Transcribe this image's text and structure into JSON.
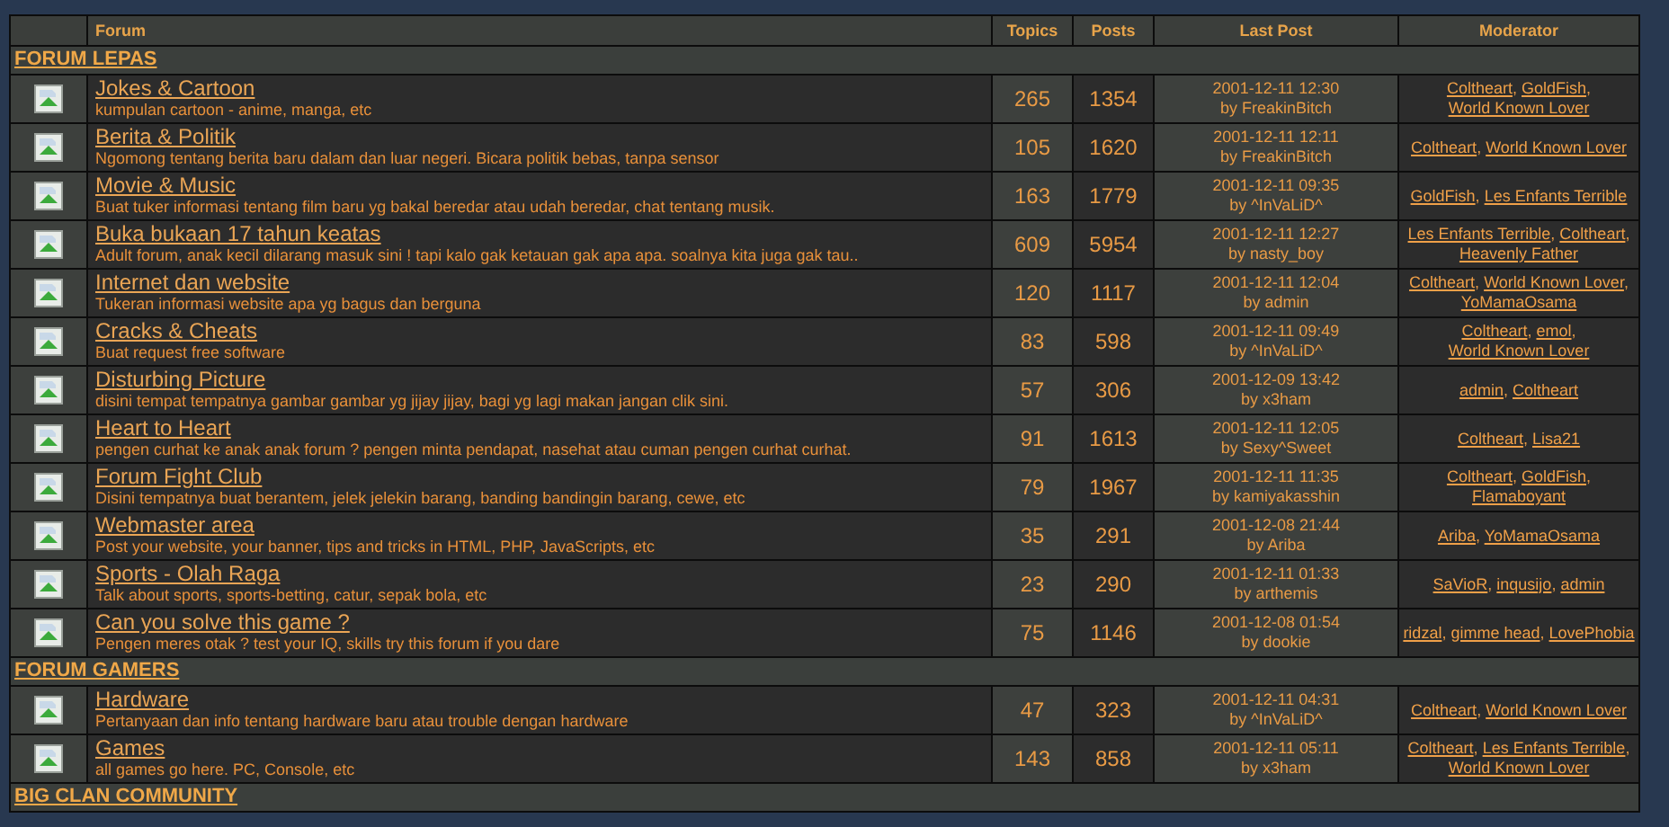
{
  "table": {
    "columns": [
      "Forum",
      "Topics",
      "Posts",
      "Last Post",
      "Moderator"
    ],
    "moderator_separator": ",",
    "categories": [
      {
        "title": "FORUM LEPAS",
        "forums": [
          {
            "name": "Jokes & Cartoon",
            "description": "kumpulan cartoon - anime, manga, etc",
            "topics": "265",
            "posts": "1354",
            "last_post": {
              "date": "2001-12-11 12:30",
              "by": "by FreakinBitch"
            },
            "moderators": [
              "Coltheart",
              "GoldFish",
              "World Known Lover"
            ]
          },
          {
            "name": "Berita & Politik",
            "description": "Ngomong tentang berita baru dalam dan luar negeri. Bicara politik bebas, tanpa sensor",
            "topics": "105",
            "posts": "1620",
            "last_post": {
              "date": "2001-12-11 12:11",
              "by": "by FreakinBitch"
            },
            "moderators": [
              "Coltheart",
              "World Known Lover"
            ]
          },
          {
            "name": "Movie & Music",
            "description": "Buat tuker informasi tentang film baru yg bakal beredar atau udah beredar, chat tentang musik.",
            "topics": "163",
            "posts": "1779",
            "last_post": {
              "date": "2001-12-11 09:35",
              "by": "by ^InVaLiD^"
            },
            "moderators": [
              "GoldFish",
              "Les Enfants Terrible"
            ]
          },
          {
            "name": "Buka bukaan 17 tahun keatas",
            "description": "Adult forum, anak kecil dilarang masuk sini ! tapi kalo gak ketauan gak apa apa. soalnya kita juga gak tau..",
            "topics": "609",
            "posts": "5954",
            "last_post": {
              "date": "2001-12-11 12:27",
              "by": "by nasty_boy"
            },
            "moderators": [
              "Les Enfants Terrible",
              "Coltheart",
              "Heavenly Father"
            ]
          },
          {
            "name": "Internet dan website",
            "description": "Tukeran informasi website apa yg bagus dan berguna",
            "topics": "120",
            "posts": "1117",
            "last_post": {
              "date": "2001-12-11 12:04",
              "by": "by admin"
            },
            "moderators": [
              "Coltheart",
              "World Known Lover",
              "YoMamaOsama"
            ]
          },
          {
            "name": "Cracks & Cheats",
            "description": "Buat request free software",
            "topics": "83",
            "posts": "598",
            "last_post": {
              "date": "2001-12-11 09:49",
              "by": "by ^InVaLiD^"
            },
            "moderators": [
              "Coltheart",
              "emol",
              "World Known Lover"
            ]
          },
          {
            "name": "Disturbing Picture",
            "description": "disini tempat tempatnya gambar gambar yg jijay jijay, bagi yg lagi makan jangan clik sini.",
            "topics": "57",
            "posts": "306",
            "last_post": {
              "date": "2001-12-09 13:42",
              "by": "by x3ham"
            },
            "moderators": [
              "admin",
              "Coltheart"
            ]
          },
          {
            "name": "Heart to Heart",
            "description": "pengen curhat ke anak anak forum ? pengen minta pendapat, nasehat atau cuman pengen curhat curhat.",
            "topics": "91",
            "posts": "1613",
            "last_post": {
              "date": "2001-12-11 12:05",
              "by": "by Sexy^Sweet"
            },
            "moderators": [
              "Coltheart",
              "Lisa21"
            ]
          },
          {
            "name": "Forum Fight Club",
            "description": "Disini tempatnya buat berantem, jelek jelekin barang, banding bandingin barang, cewe, etc",
            "topics": "79",
            "posts": "1967",
            "last_post": {
              "date": "2001-12-11 11:35",
              "by": "by kamiyakasshin"
            },
            "moderators": [
              "Coltheart",
              "GoldFish",
              "Flamaboyant"
            ]
          },
          {
            "name": "Webmaster area",
            "description": "Post your website, your banner, tips and tricks in HTML, PHP, JavaScripts, etc",
            "topics": "35",
            "posts": "291",
            "last_post": {
              "date": "2001-12-08 21:44",
              "by": "by Ariba"
            },
            "moderators": [
              "Ariba",
              "YoMamaOsama"
            ]
          },
          {
            "name": "Sports - Olah Raga",
            "description": "Talk about sports, sports-betting, catur, sepak bola, etc",
            "topics": "23",
            "posts": "290",
            "last_post": {
              "date": "2001-12-11 01:33",
              "by": "by arthemis"
            },
            "moderators": [
              "SaVioR",
              "inqusijo",
              "admin"
            ]
          },
          {
            "name": "Can you solve this game ?",
            "description": "Pengen meres otak ? test your IQ, skills try this forum if you dare",
            "topics": "75",
            "posts": "1146",
            "last_post": {
              "date": "2001-12-08 01:54",
              "by": "by dookie"
            },
            "moderators": [
              "ridzal",
              "gimme head",
              "LovePhobia"
            ]
          }
        ]
      },
      {
        "title": "FORUM GAMERS",
        "forums": [
          {
            "name": "Hardware",
            "description": "Pertanyaan dan info tentang hardware baru atau trouble dengan hardware",
            "topics": "47",
            "posts": "323",
            "last_post": {
              "date": "2001-12-11 04:31",
              "by": "by ^InVaLiD^"
            },
            "moderators": [
              "Coltheart",
              "World Known Lover"
            ]
          },
          {
            "name": "Games",
            "description": "all games go here. PC, Console, etc",
            "topics": "143",
            "posts": "858",
            "last_post": {
              "date": "2001-12-11 05:11",
              "by": "by x3ham"
            },
            "moderators": [
              "Coltheart",
              "Les Enfants Terrible",
              "World Known Lover"
            ]
          }
        ]
      },
      {
        "title": "BIG CLAN COMMUNITY"
      }
    ]
  }
}
